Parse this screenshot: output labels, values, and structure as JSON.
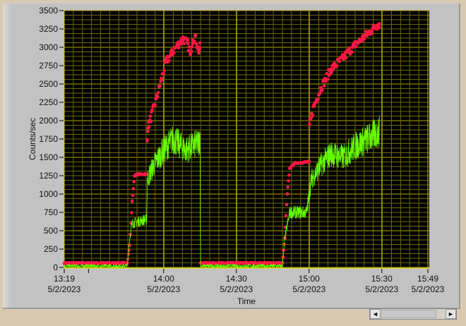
{
  "chart_data": {
    "type": "scatter",
    "title": "",
    "xlabel": "Time",
    "ylabel": "Counts/sec",
    "ylim": [
      0,
      3500
    ],
    "xlim_minutes_from_start": [
      0,
      150
    ],
    "y_ticks": [
      "0",
      "250",
      "500",
      "750",
      "1000",
      "1250",
      "1500",
      "1750",
      "2000",
      "2250",
      "2500",
      "2750",
      "3000",
      "3250",
      "3500"
    ],
    "x_ticks": [
      {
        "t": 0,
        "time": "13:19",
        "date": "5/2/2023"
      },
      {
        "t": 41,
        "time": "14:00",
        "date": "5/2/2023"
      },
      {
        "t": 71,
        "time": "14:30",
        "date": "5/2/2023"
      },
      {
        "t": 101,
        "time": "15:00",
        "date": "5/2/2023"
      },
      {
        "t": 131,
        "time": "15:30",
        "date": "5/2/2023"
      },
      {
        "t": 150,
        "time": "15:49",
        "date": "5/2/2023"
      }
    ],
    "grid": true,
    "series": [
      {
        "name": "red",
        "color": "#ff1744",
        "style": "points",
        "points": [
          [
            0,
            60
          ],
          [
            26,
            60
          ],
          [
            27,
            300
          ],
          [
            28,
            900
          ],
          [
            29,
            1250
          ],
          [
            30,
            1270
          ],
          [
            34,
            1270
          ],
          [
            34.2,
            1720
          ],
          [
            34.5,
            1900
          ],
          [
            38,
            2300
          ],
          [
            42,
            2800
          ],
          [
            46,
            3000
          ],
          [
            49,
            3120
          ],
          [
            51,
            3050
          ],
          [
            52,
            2900
          ],
          [
            53,
            3100
          ],
          [
            54,
            3150
          ],
          [
            55.5,
            2950
          ],
          [
            56,
            3000
          ],
          [
            56.2,
            60
          ],
          [
            90,
            60
          ],
          [
            91,
            400
          ],
          [
            92,
            1000
          ],
          [
            93,
            1350
          ],
          [
            95,
            1420
          ],
          [
            101,
            1440
          ],
          [
            101.2,
            1950
          ],
          [
            103,
            2200
          ],
          [
            106,
            2450
          ],
          [
            110,
            2700
          ],
          [
            115,
            2850
          ],
          [
            119,
            3000
          ],
          [
            124,
            3150
          ],
          [
            129,
            3300
          ],
          [
            130,
            3320
          ]
        ]
      },
      {
        "name": "green",
        "color": "#66ff00",
        "style": "line",
        "points": [
          [
            0,
            20
          ],
          [
            26,
            20
          ],
          [
            27,
            400
          ],
          [
            28,
            600
          ],
          [
            33,
            650
          ],
          [
            34,
            650
          ],
          [
            34.3,
            1200
          ],
          [
            37,
            1400
          ],
          [
            41,
            1600
          ],
          [
            45,
            1750
          ],
          [
            50,
            1600
          ],
          [
            55.5,
            1700
          ],
          [
            56,
            1800
          ],
          [
            56.2,
            20
          ],
          [
            90,
            20
          ],
          [
            91,
            400
          ],
          [
            93,
            750
          ],
          [
            100,
            750
          ],
          [
            101,
            1000
          ],
          [
            102,
            1200
          ],
          [
            106,
            1400
          ],
          [
            110,
            1550
          ],
          [
            115,
            1500
          ],
          [
            120,
            1650
          ],
          [
            125,
            1750
          ],
          [
            130,
            1850
          ]
        ]
      }
    ]
  },
  "scrollbar": {
    "left_arrow": "◄",
    "right_arrow": "►"
  }
}
